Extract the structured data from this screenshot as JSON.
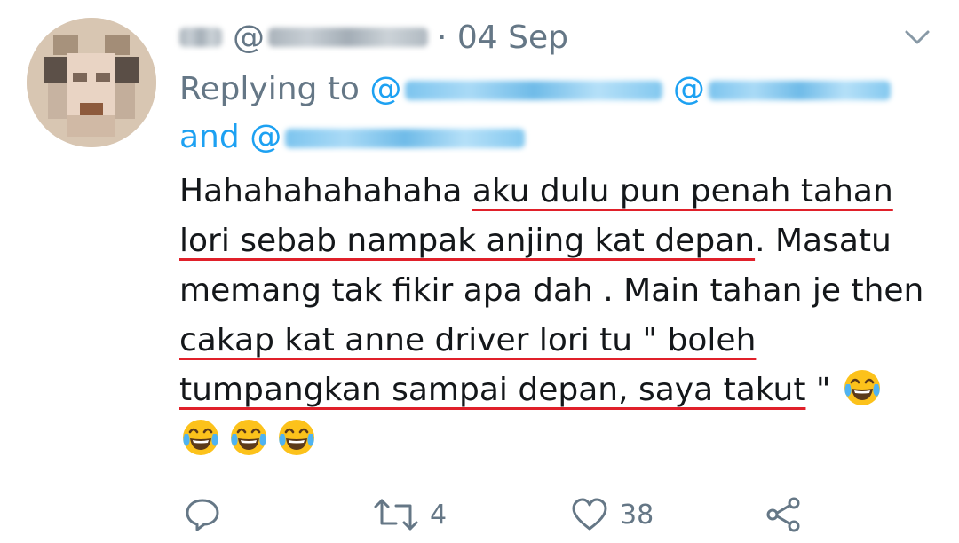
{
  "tweet": {
    "timestamp": "· 04 Sep",
    "at_symbol": "@",
    "replying_label": "Replying to",
    "and_label": "and",
    "mention_prefix": "@",
    "body": {
      "intro": "Hahahahahahaha ",
      "underlined_1": "aku dulu pun penah tahan lori sebab nampak anjing kat depan",
      "middle": ". Masatu memang tak fikir apa dah . Main tahan je then ",
      "underlined_2": "cakap kat anne driver lori tu \" boleh tumpangkan sampai depan, saya takut",
      "outro": " \" "
    }
  },
  "actions": {
    "reply_icon": "reply-icon",
    "retweet_icon": "retweet-icon",
    "retweet_count": "4",
    "like_icon": "heart-icon",
    "like_count": "38",
    "share_icon": "share-icon"
  },
  "colors": {
    "mention": "#1da1f2",
    "muted": "#657786",
    "text": "#14171a",
    "underline": "#e0202a"
  }
}
